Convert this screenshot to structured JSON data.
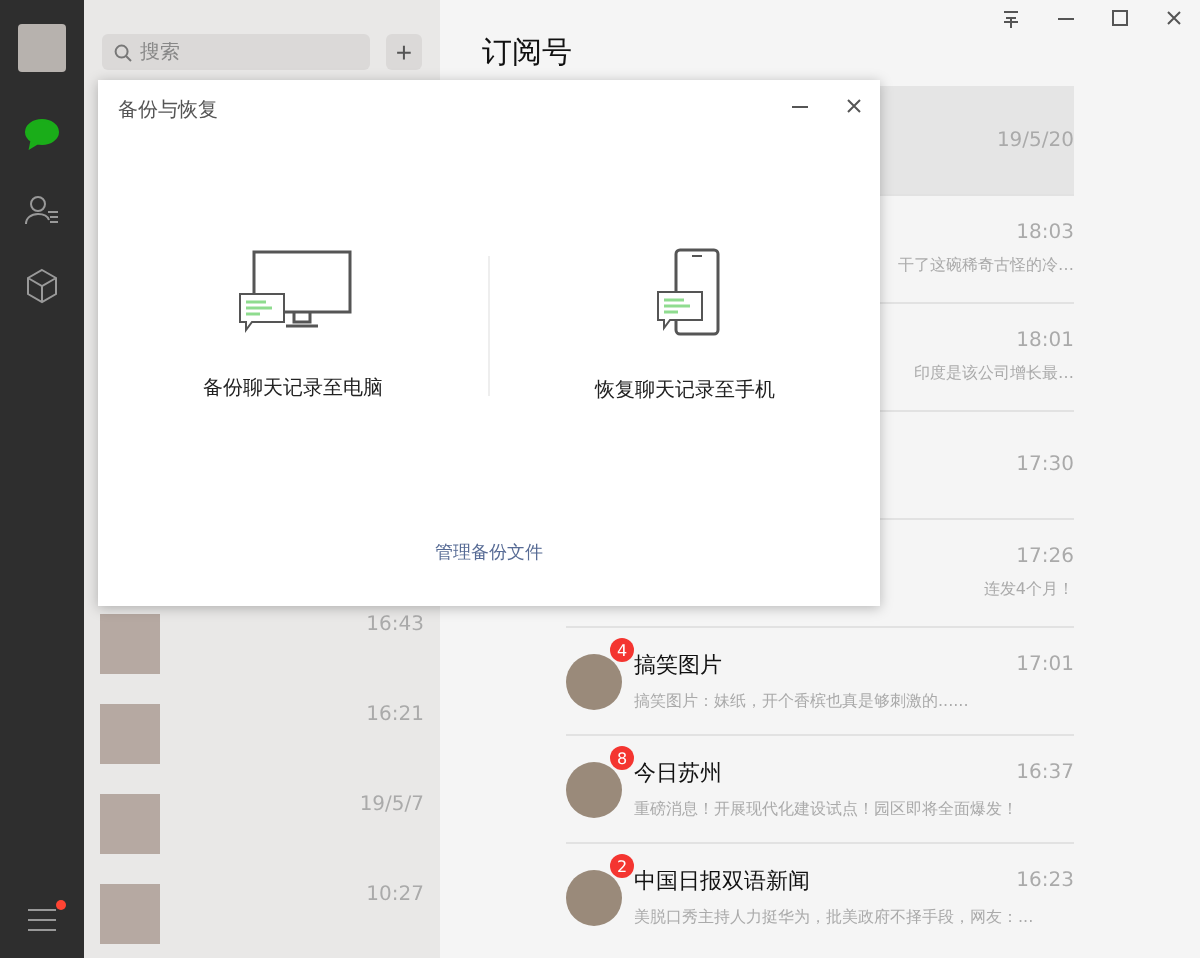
{
  "sidebar": {
    "nav": [
      {
        "kind": "chat",
        "selected": true
      },
      {
        "kind": "contacts",
        "selected": false
      },
      {
        "kind": "box",
        "selected": false
      }
    ],
    "menu": {
      "unread": true
    }
  },
  "chat_list": {
    "search": {
      "placeholder": "搜索"
    },
    "add_button": "+",
    "rows": [
      {
        "time": "16:43"
      },
      {
        "time": "16:21"
      },
      {
        "time": "19/5/7"
      },
      {
        "time": "10:27"
      }
    ]
  },
  "panel": {
    "title": "订阅号",
    "items": [
      {
        "time": "19/5/20",
        "selected": true
      },
      {
        "time": "18:03",
        "preview": "干了这碗稀奇古怪的冷…",
        "selected": false
      },
      {
        "time": "18:01",
        "preview": "印度是该公司增长最…",
        "selected": false
      },
      {
        "time": "17:30",
        "selected": false
      },
      {
        "time": "17:26",
        "preview": "连发4个月！",
        "selected": false
      },
      {
        "name": "搞笑图片",
        "time": "17:01",
        "preview": "搞笑图片：妹纸，开个香槟也真是够刺激的......",
        "badge": "4",
        "selected": false
      },
      {
        "name": "今日苏州",
        "time": "16:37",
        "preview": "重磅消息！开展现代化建设试点！园区即将全面爆发！",
        "badge": "8",
        "selected": false
      },
      {
        "name": "中国日报双语新闻",
        "time": "16:23",
        "preview": "美脱口秀主持人力挺华为，批美政府不择手段，网友：...",
        "badge": "2",
        "selected": false
      }
    ]
  },
  "dialog": {
    "title": "备份与恢复",
    "options": [
      {
        "kind": "computer",
        "label": "备份聊天记录至电脑"
      },
      {
        "kind": "phone",
        "label": "恢复聊天记录至手机"
      }
    ],
    "link": "管理备份文件"
  }
}
